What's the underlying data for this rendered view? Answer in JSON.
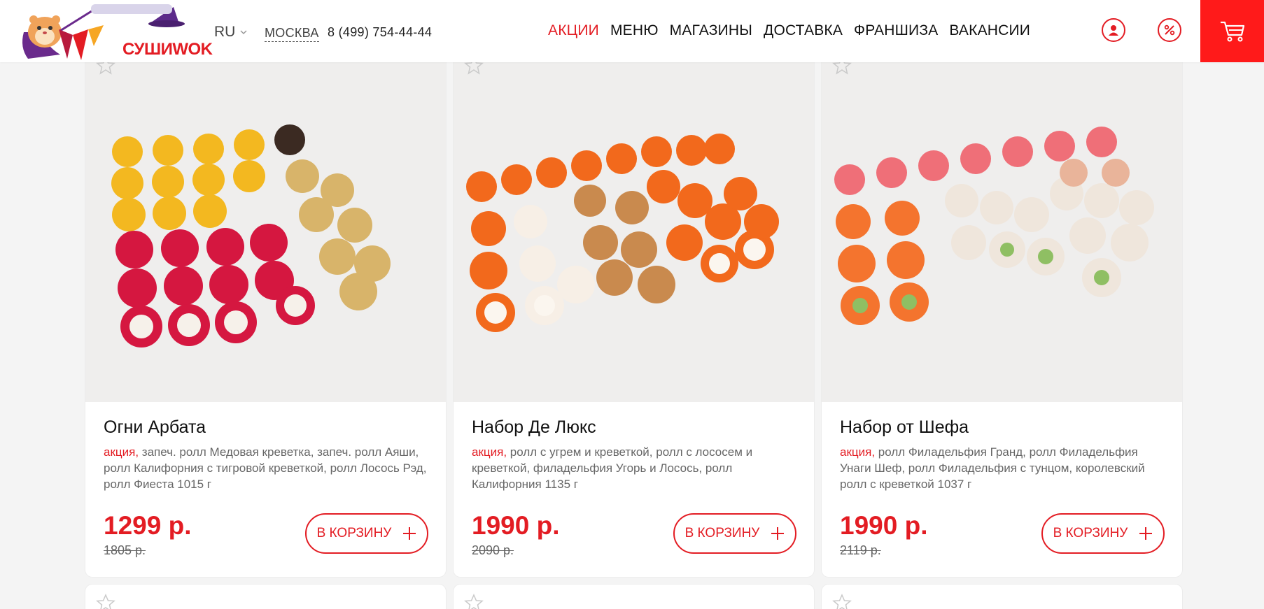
{
  "header": {
    "logo_text": "СУШИWOK",
    "language": "RU",
    "city": "МОСКВА",
    "phone": "8 (499) 754-44-44",
    "nav": [
      {
        "label": "АКЦИИ",
        "active": true
      },
      {
        "label": "МЕНЮ",
        "active": false
      },
      {
        "label": "МАГАЗИНЫ",
        "active": false
      },
      {
        "label": "ДОСТАВКА",
        "active": false
      },
      {
        "label": "ФРАНШИЗА",
        "active": false
      },
      {
        "label": "ВАКАНСИИ",
        "active": false
      }
    ],
    "icons": [
      "user-icon",
      "percent-icon",
      "cart-icon"
    ]
  },
  "products": [
    {
      "title": "Огни Арбата",
      "tag": "акция,",
      "description": " запеч. ролл Медовая креветка, запеч. ролл Аяши, ролл Калифорния с тигровой креветкой, ролл Лосось Рэд, ролл Фиеста 1015 г",
      "price": "1299 р.",
      "old_price": "1805 р.",
      "button": "В КОРЗИНУ"
    },
    {
      "title": "Набор Де Люкс",
      "tag": "акция,",
      "description": " ролл с угрем и креветкой, ролл с лососем и креветкой, филадельфия Угорь и Лосось, ролл Калифорния 1135 г",
      "price": "1990 р.",
      "old_price": "2090 р.",
      "button": "В КОРЗИНУ"
    },
    {
      "title": "Набор от Шефа",
      "tag": "акция,",
      "description": " ролл Филадельфия Гранд, ролл Филадельфия Унаги Шеф, ролл Филадельфия с тунцом, королевский ролл с креветкой 1037 г",
      "price": "1990 р.",
      "old_price": "2119 р.",
      "button": "В КОРЗИНУ"
    }
  ],
  "colors": {
    "accent": "#e31c23",
    "cart_bg": "#ff1a1a",
    "text": "#222222",
    "muted": "#666666"
  }
}
